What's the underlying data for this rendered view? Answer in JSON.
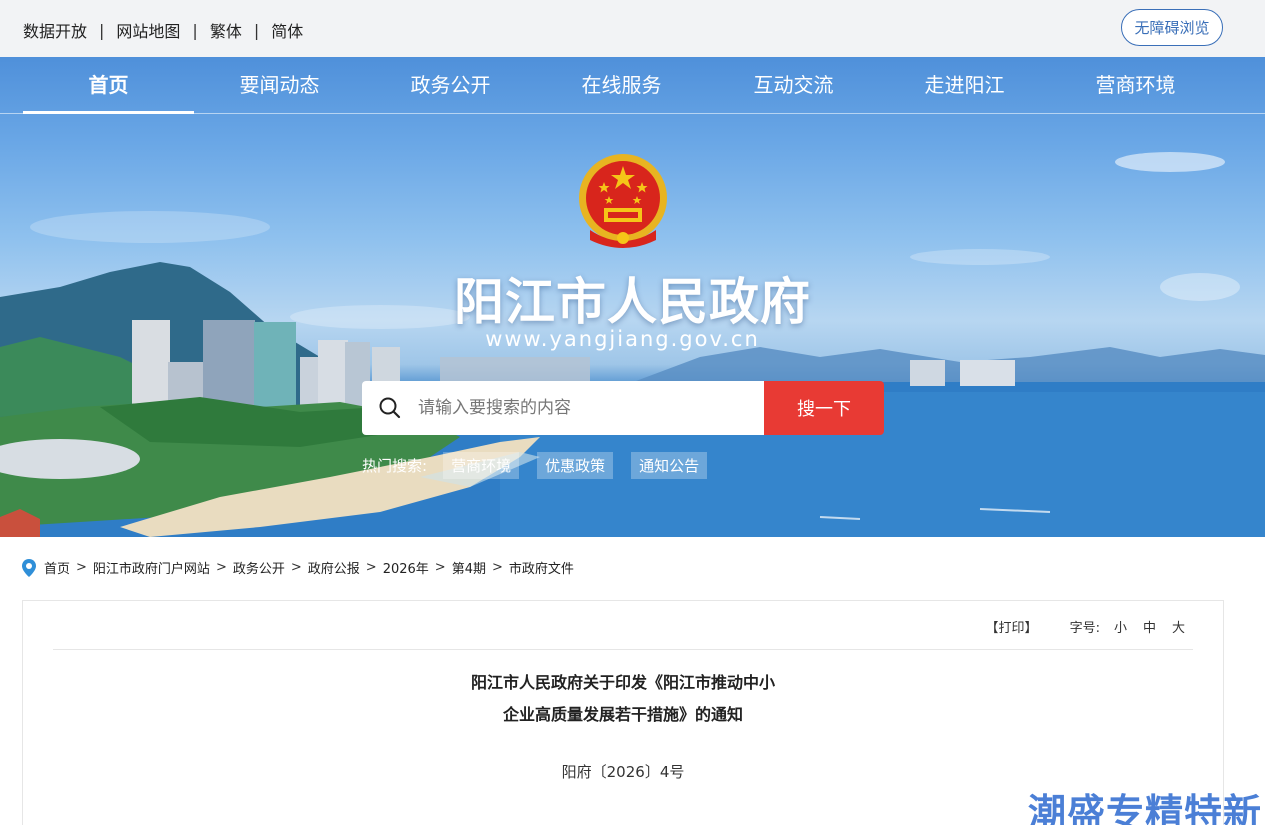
{
  "topbar": {
    "links": [
      "数据开放",
      "网站地图",
      "繁体",
      "简体"
    ],
    "separator": "|",
    "accessible_label": "无障碍浏览"
  },
  "nav": {
    "items": [
      "首页",
      "要闻动态",
      "政务公开",
      "在线服务",
      "互动交流",
      "走进阳江",
      "营商环境"
    ],
    "active": "首页"
  },
  "banner": {
    "title": "阳江市人民政府",
    "domain": "www.yangjiang.gov.cn"
  },
  "search": {
    "placeholder": "请输入要搜索的内容",
    "button_label": "搜一下",
    "hot_label": "热门搜索:",
    "hot_tags": [
      "营商环境",
      "优惠政策",
      "通知公告"
    ]
  },
  "breadcrumb": {
    "items": [
      "首页",
      "阳江市政府门户网站",
      "政务公开",
      "政府公报",
      "2026年",
      "第4期",
      "市政府文件"
    ],
    "separator": ">"
  },
  "article": {
    "print_label": "【打印】",
    "font_size_label": "字号:",
    "font_sizes": [
      "小",
      "中",
      "大"
    ],
    "title_line1": "阳江市人民政府关于印发《阳江市推动中小",
    "title_line2": "企业高质量发展若干措施》的通知",
    "doc_number": "阳府〔2026〕4号"
  },
  "watermark": {
    "text": "潮盛专精特新"
  },
  "colors": {
    "search_button": "#e83a34",
    "accessible_border": "#3a6fb8",
    "watermark": "#4b7fd6"
  }
}
